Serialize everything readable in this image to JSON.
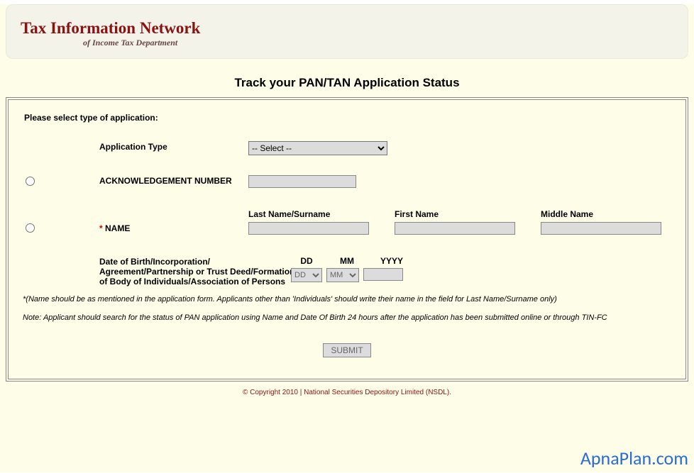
{
  "header": {
    "title": "Tax Information Network",
    "subtitle": "of Income Tax Department"
  },
  "page_heading": "Track your PAN/TAN Application Status",
  "form": {
    "section_label": "Please select type of application:",
    "app_type_label": "Application Type",
    "app_type_selected": "-- Select --",
    "ack_label": "ACKNOWLEDGEMENT NUMBER",
    "name_label": "NAME",
    "name_star": "* ",
    "last_name_label": "Last Name/Surname",
    "first_name_label": "First Name",
    "middle_name_label": "Middle Name",
    "dob_label": "Date of Birth/Incorporation/ Agreement/Partnership or Trust Deed/Formation of Body of Individuals/Association of Persons",
    "dd_label": "DD",
    "mm_label": "MM",
    "yyyy_label": "YYYY",
    "dd_option": "DD",
    "mm_option": "MM"
  },
  "notes": {
    "note1": "*(Name should be as mentioned in the application form. Applicants other than 'Individuals' should write their name in the field for Last Name/Surname only)",
    "note2": "Note: Applicant should search for the status of PAN application using Name and Date Of Birth 24 hours after the application has been submitted online or through TIN-FC"
  },
  "submit_label": "SUBMIT",
  "footer": "© Copyright 2010  |  National Securities Depository Limited (NSDL).",
  "watermark": "ApnaPlan.com"
}
